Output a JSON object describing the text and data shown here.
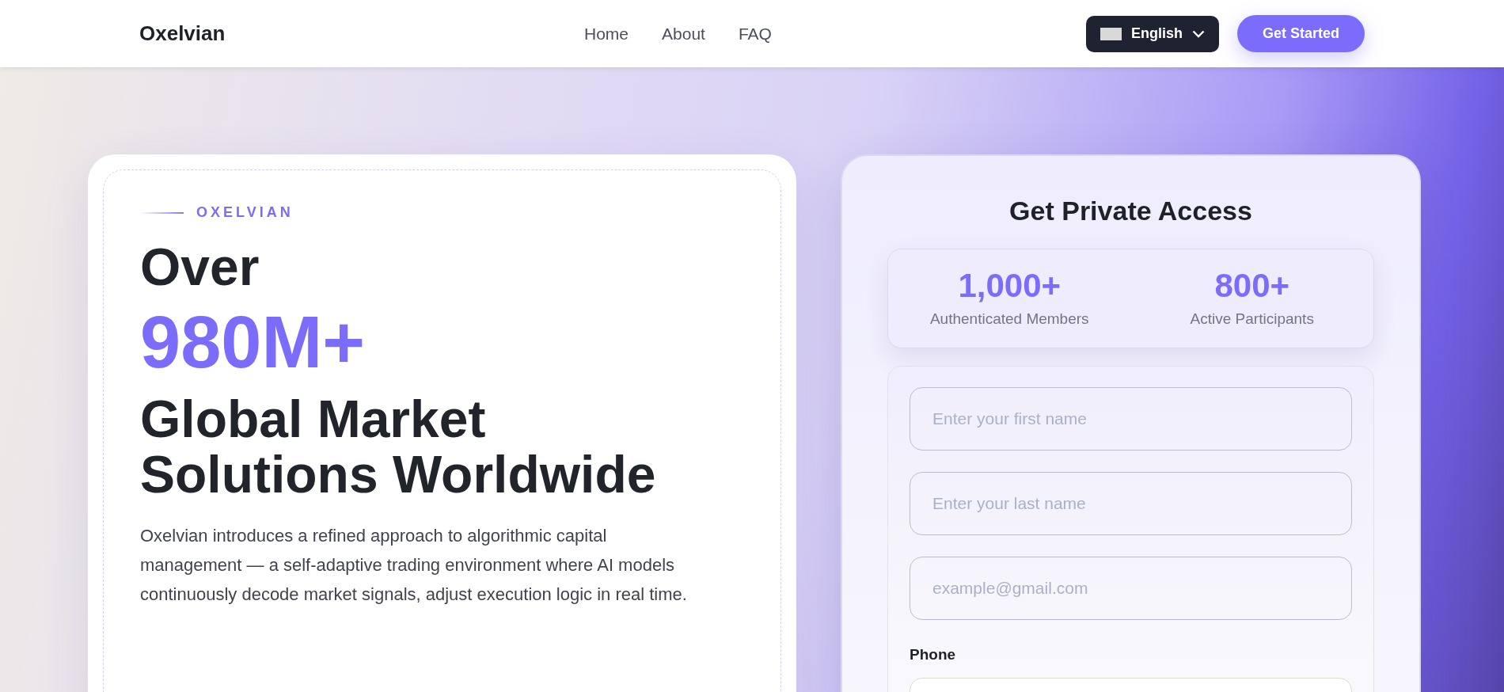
{
  "header": {
    "logo": "Oxelvian",
    "nav": [
      {
        "label": "Home"
      },
      {
        "label": "About"
      },
      {
        "label": "FAQ"
      }
    ],
    "language": {
      "label": "English"
    },
    "cta": "Get Started"
  },
  "hero": {
    "eyebrow": "OXELVIAN",
    "line_1": "Over",
    "highlight": "980M+",
    "line_2": "Global Market Solutions Worldwide",
    "description": "Oxelvian introduces a refined approach to algorithmic capital management — a self-adaptive trading environment where AI models continuously decode market signals, adjust execution logic in real time."
  },
  "form": {
    "title": "Get Private Access",
    "stats": [
      {
        "value": "1,000+",
        "label": "Authenticated Members"
      },
      {
        "value": "800+",
        "label": "Active Participants"
      }
    ],
    "fields": [
      {
        "placeholder": "Enter your first name"
      },
      {
        "placeholder": "Enter your last name"
      },
      {
        "placeholder": "example@gmail.com"
      }
    ],
    "phone_label": "Phone"
  }
}
